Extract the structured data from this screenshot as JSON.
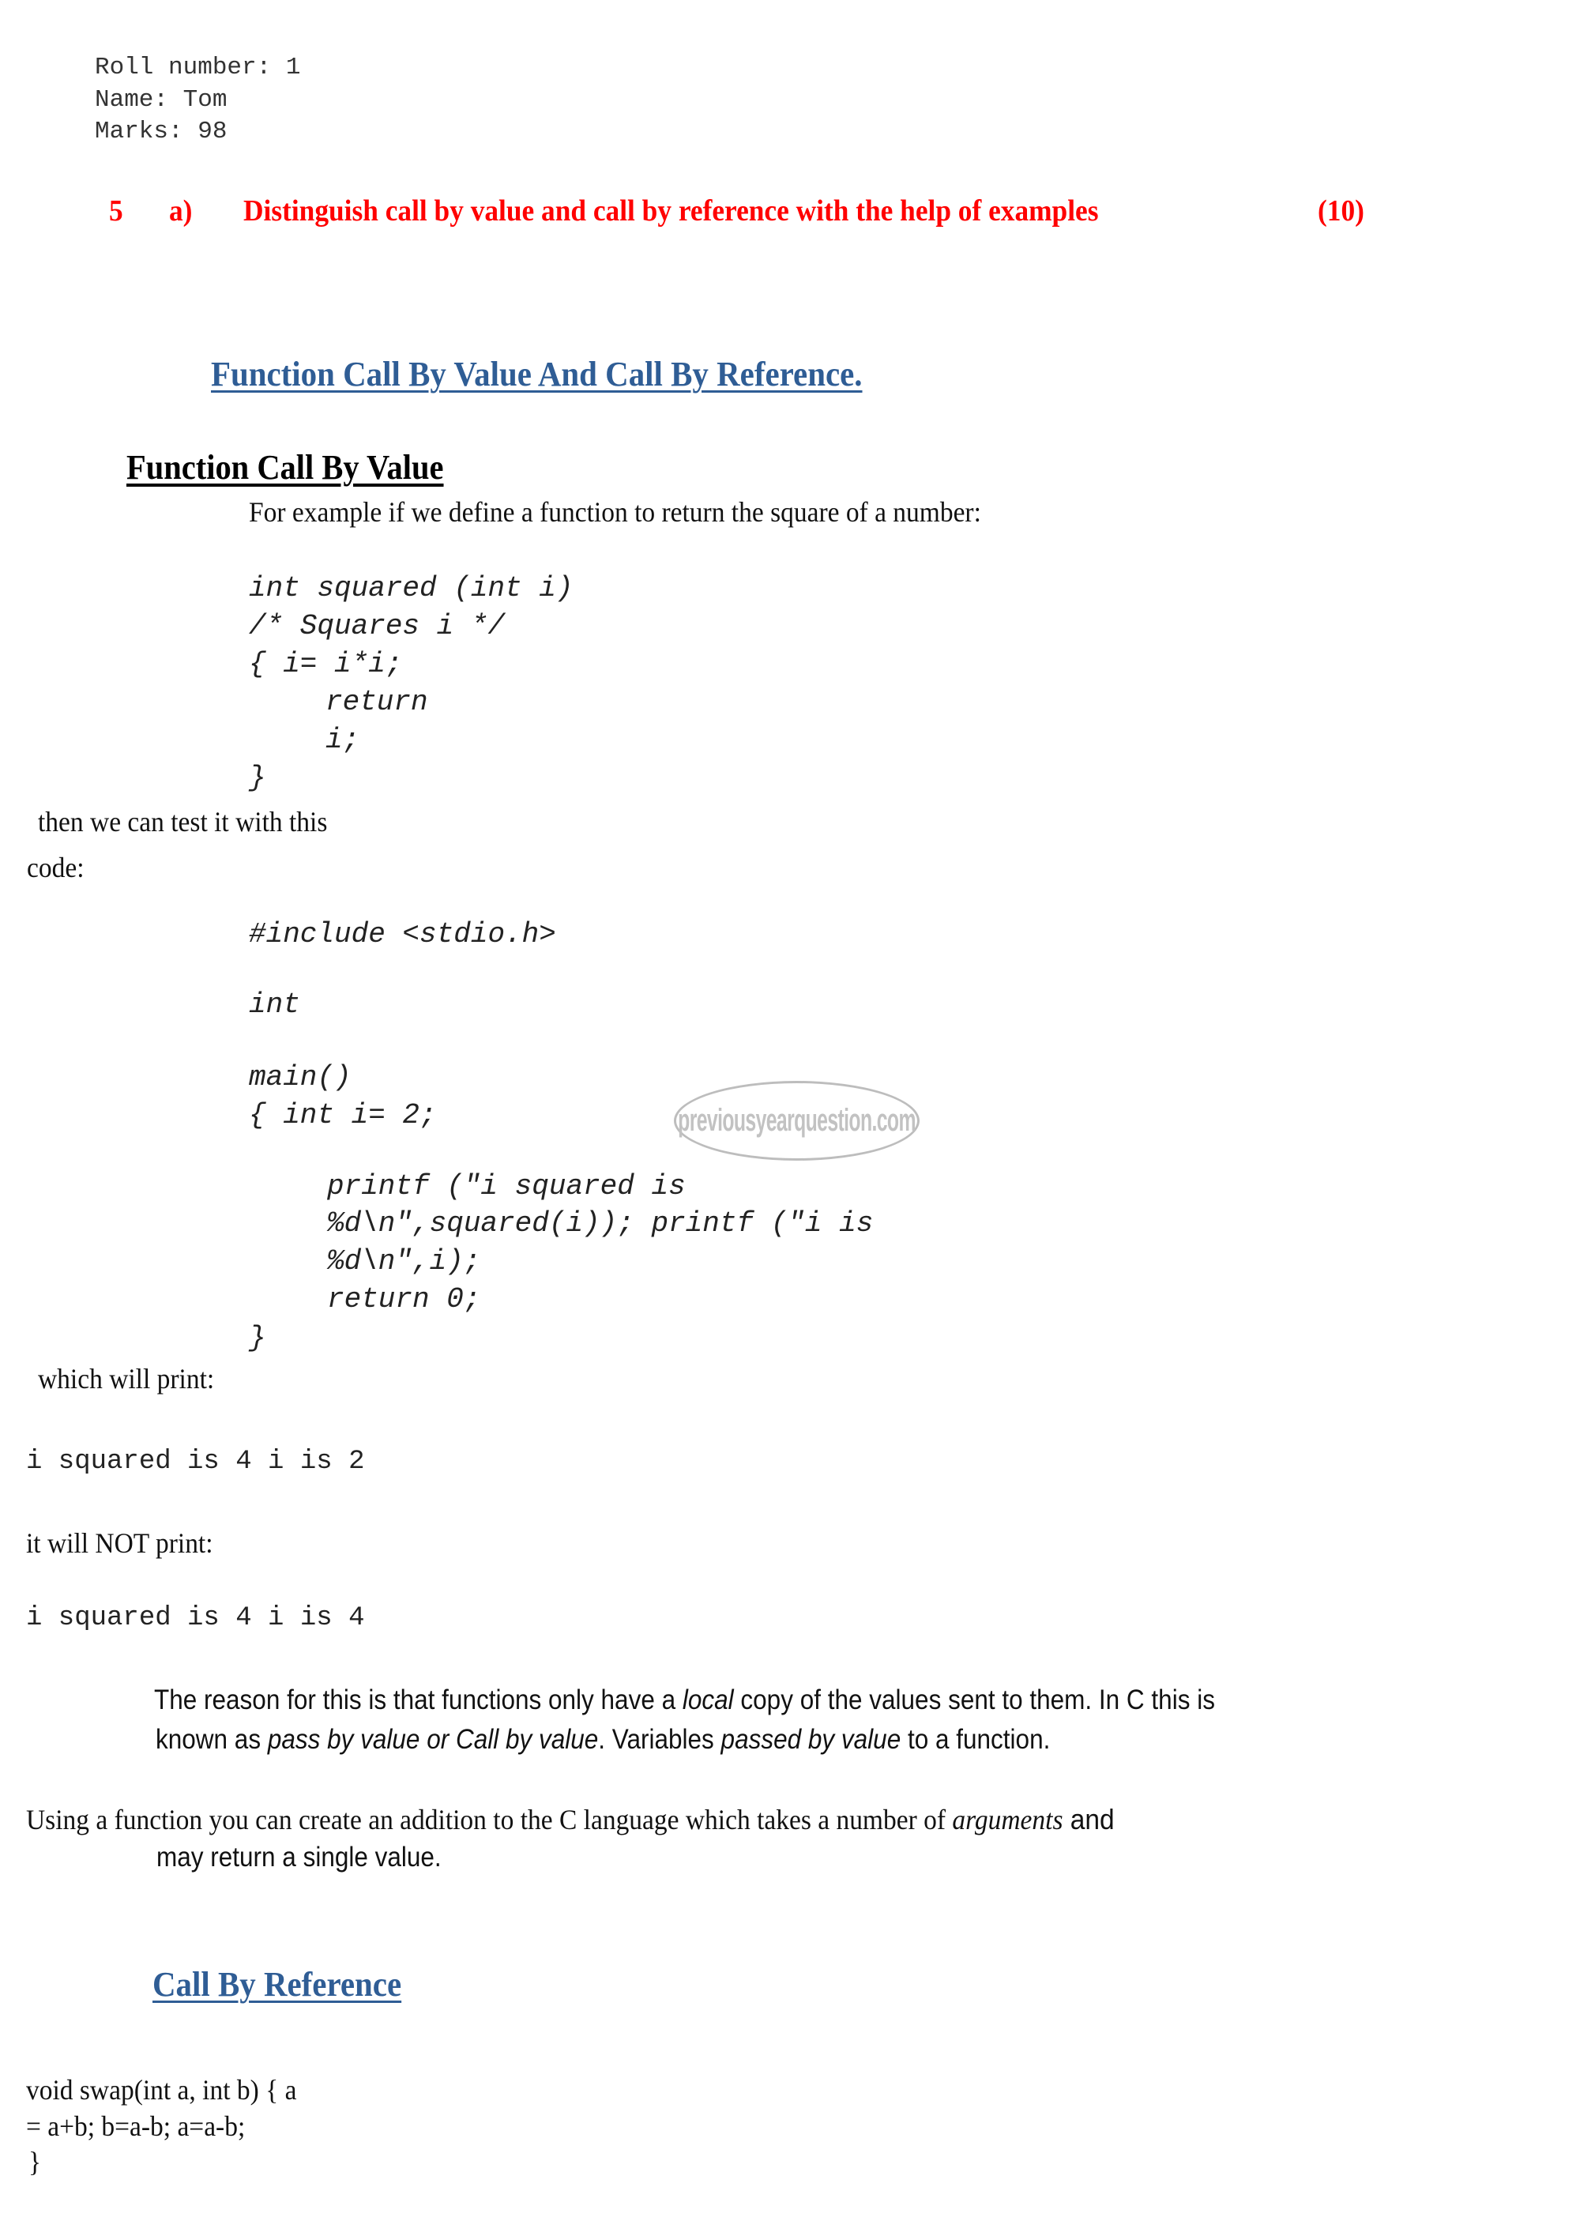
{
  "student": {
    "roll_line": "Roll number: 1",
    "name_line": "Name: Tom",
    "marks_line": "Marks: 98"
  },
  "question": {
    "number": "5",
    "part": "a)",
    "text": "Distinguish call by value and call by reference with the help of examples",
    "marks": "(10)",
    "color": "#ff0000"
  },
  "main_heading": {
    "text": "Function Call By Value And Call By Reference.",
    "color": "#2f5d95"
  },
  "call_by_value": {
    "heading": "Function Call By Value",
    "intro": "For example if we define a function to return the square of a number:",
    "function_code": [
      "int squared (int i)",
      "/* Squares i */",
      "{ i= i*i;",
      "return",
      "i;",
      "}"
    ],
    "test_text_1": "then we can test it with this",
    "test_text_2": "code:",
    "test_code": {
      "include": "#include <stdio.h>",
      "int": "int",
      "main": "main()",
      "decl": "{ int i= 2;",
      "body": [
        "printf (\"i squared is",
        "%d\\n\",squared(i)); printf (\"i is",
        "%d\\n\",i);",
        "return 0;"
      ],
      "close": "}"
    },
    "will_print_label": "which will print:",
    "will_print_output": "i squared is 4 i is 2",
    "will_not_print_label": "it will NOT print:",
    "will_not_print_output": "i squared is 4 i is 4",
    "reason": {
      "p1_a": "The reason for this is that functions only have a ",
      "p1_em": "local",
      "p1_b": " copy of the values sent to them. In C this is",
      "p2_a": "known as ",
      "p2_em1": "pass by value or Call by value",
      "p2_b": ". Variables ",
      "p2_em2": "passed by value",
      "p2_c": " to a function."
    },
    "usage": {
      "line1_a": "Using a function you can create an addition to the C language which takes a number of ",
      "line1_em": "arguments",
      "line1_b": " and",
      "line2": "may return a single value."
    }
  },
  "call_by_reference": {
    "heading": "Call By Reference",
    "code": [
      "void swap(int a, int b) { a",
      "= a+b; b=a-b; a=a-b;",
      "}"
    ]
  },
  "watermark": {
    "text": "previousyearquestion.com"
  }
}
